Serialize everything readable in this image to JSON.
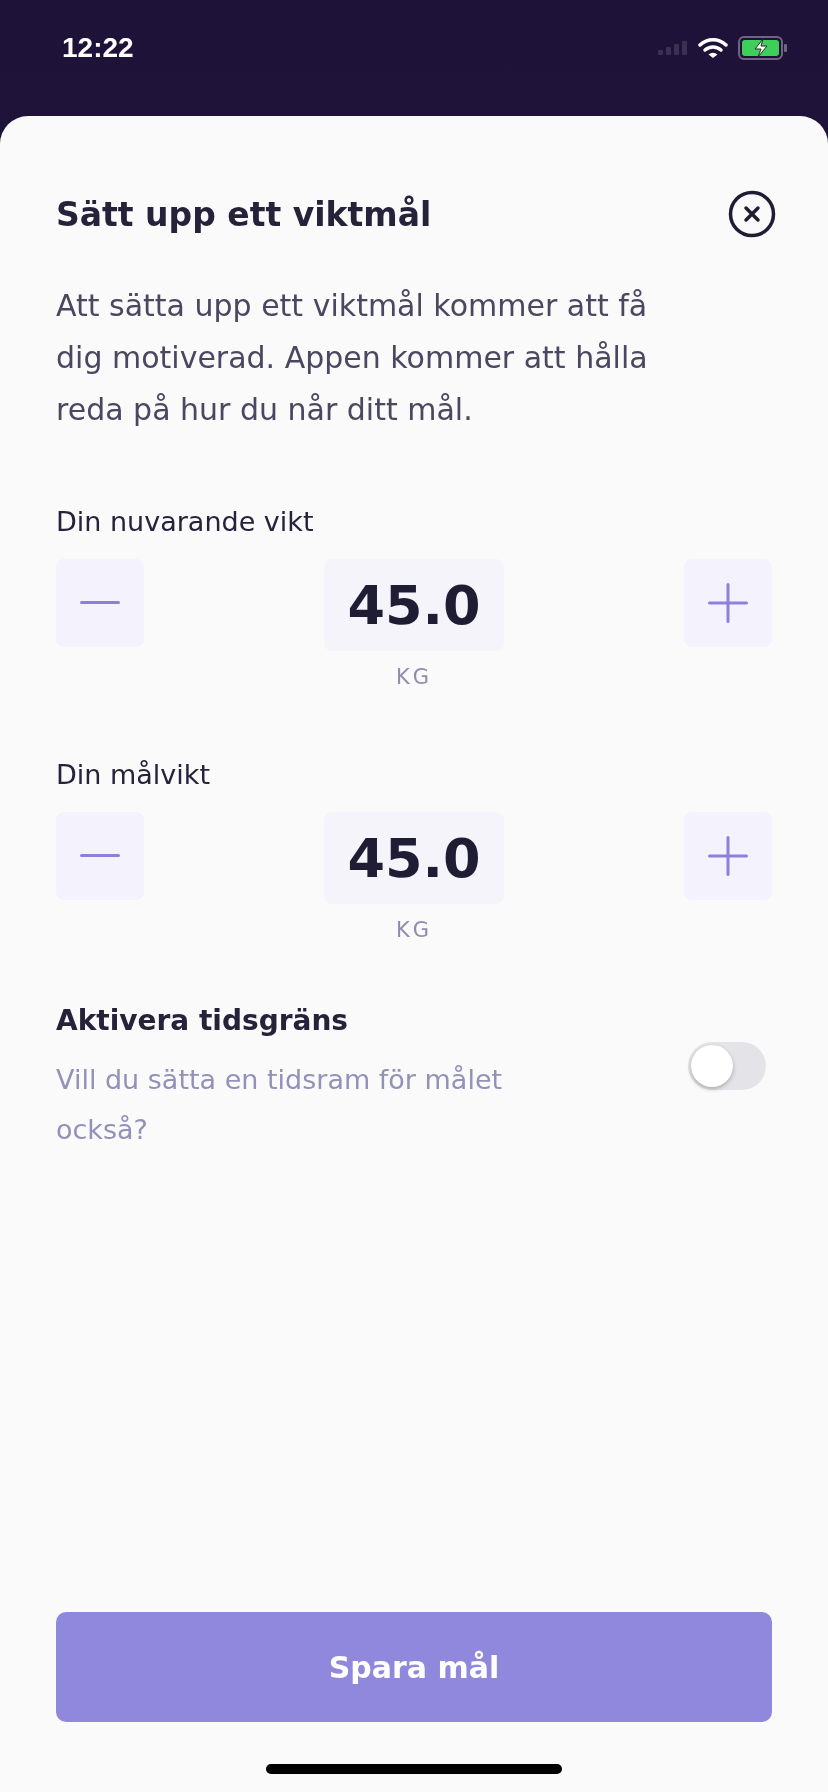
{
  "status_bar": {
    "time": "12:22"
  },
  "sheet": {
    "title": "Sätt upp ett viktmål",
    "description": "Att sätta upp ett viktmål kommer att få dig motiverad. Appen kommer att hålla reda på hur du når ditt mål.",
    "steppers": [
      {
        "label": "Din nuvarande vikt",
        "value": "45.0",
        "unit": "KG"
      },
      {
        "label": "Din målvikt",
        "value": "45.0",
        "unit": "KG"
      }
    ],
    "time_limit": {
      "title": "Aktivera tidsgräns",
      "subtitle": "Vill du sätta en tidsram för målet också?",
      "on": false
    },
    "save_button": "Spara mål"
  }
}
